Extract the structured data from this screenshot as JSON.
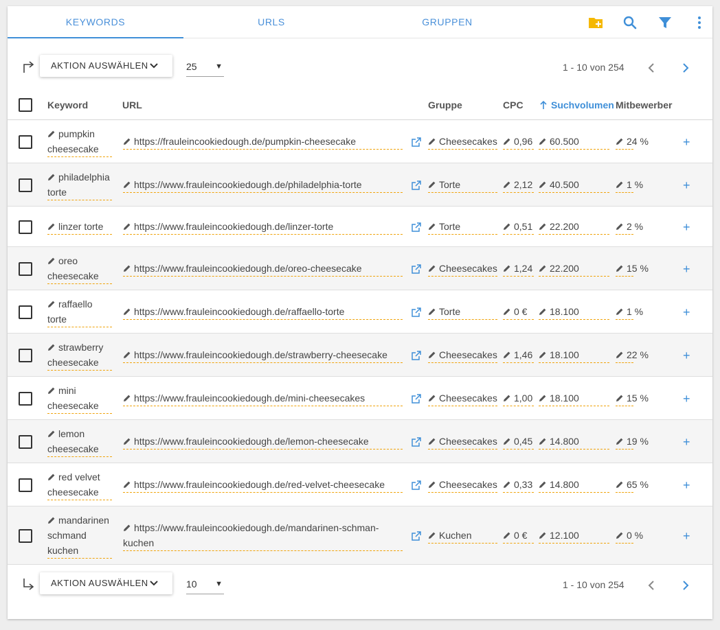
{
  "tabs": [
    "KEYWORDS",
    "URLS",
    "GRUPPEN"
  ],
  "toolbar": {
    "action_label": "AKTION AUSWÄHLEN",
    "per_page_top": "25",
    "per_page_bottom": "10",
    "page_info_top": "1 - 10 von 254",
    "page_info_bottom": "1 - 10 von 254"
  },
  "columns": {
    "keyword": "Keyword",
    "url": "URL",
    "group": "Gruppe",
    "cpc": "CPC",
    "volume": "Suchvolumen",
    "competitors": "Mitbewerber"
  },
  "colors": {
    "accent": "#3f8fd8",
    "folder": "#f5b800",
    "dashed_underline": "#f0a30a"
  },
  "rows": [
    {
      "keyword": [
        "pumpkin",
        "cheesecake"
      ],
      "url": [
        "https://frauleincookiedough.de/pumpkin-cheesecake"
      ],
      "group": "Cheesecakes",
      "cpc": "0,96",
      "volume": "60.500",
      "competitors": "24 %"
    },
    {
      "keyword": [
        "philadelphia",
        "torte"
      ],
      "url": [
        "https://www.frauleincookiedough.de/philadelphia-torte"
      ],
      "group": "Torte",
      "cpc": "2,12",
      "volume": "40.500",
      "competitors": "1 %"
    },
    {
      "keyword": [
        "linzer torte"
      ],
      "url": [
        "https://www.frauleincookiedough.de/linzer-torte"
      ],
      "group": "Torte",
      "cpc": "0,51",
      "volume": "22.200",
      "competitors": "2 %"
    },
    {
      "keyword": [
        "oreo",
        "cheesecake"
      ],
      "url": [
        "https://www.frauleincookiedough.de/oreo-cheesecake"
      ],
      "group": "Cheesecakes",
      "cpc": "1,24",
      "volume": "22.200",
      "competitors": "15 %"
    },
    {
      "keyword": [
        "raffaello",
        "torte"
      ],
      "url": [
        "https://www.frauleincookiedough.de/raffaello-torte"
      ],
      "group": "Torte",
      "cpc": "0 €",
      "volume": "18.100",
      "competitors": "1 %"
    },
    {
      "keyword": [
        "strawberry",
        "cheesecake"
      ],
      "url": [
        "https://www.frauleincookiedough.de/strawberry-cheesecake"
      ],
      "group": "Cheesecakes",
      "cpc": "1,46",
      "volume": "18.100",
      "competitors": "22 %"
    },
    {
      "keyword": [
        "mini",
        "cheesecake"
      ],
      "url": [
        "https://www.frauleincookiedough.de/mini-cheesecakes"
      ],
      "group": "Cheesecakes",
      "cpc": "1,00",
      "volume": "18.100",
      "competitors": "15 %"
    },
    {
      "keyword": [
        "lemon",
        "cheesecake"
      ],
      "url": [
        "https://www.frauleincookiedough.de/lemon-cheesecake"
      ],
      "group": "Cheesecakes",
      "cpc": "0,45",
      "volume": "14.800",
      "competitors": "19 %"
    },
    {
      "keyword": [
        "red velvet",
        "cheesecake"
      ],
      "url": [
        "https://www.frauleincookiedough.de/red-velvet-cheesecake"
      ],
      "group": "Cheesecakes",
      "cpc": "0,33",
      "volume": "14.800",
      "competitors": "65 %"
    },
    {
      "keyword": [
        "mandarinen",
        "schmand",
        "kuchen"
      ],
      "url": [
        "https://www.frauleincookiedough.de/mandarinen-schman-",
        "kuchen"
      ],
      "group": "Kuchen",
      "cpc": "0 €",
      "volume": "12.100",
      "competitors": "0 %"
    }
  ]
}
